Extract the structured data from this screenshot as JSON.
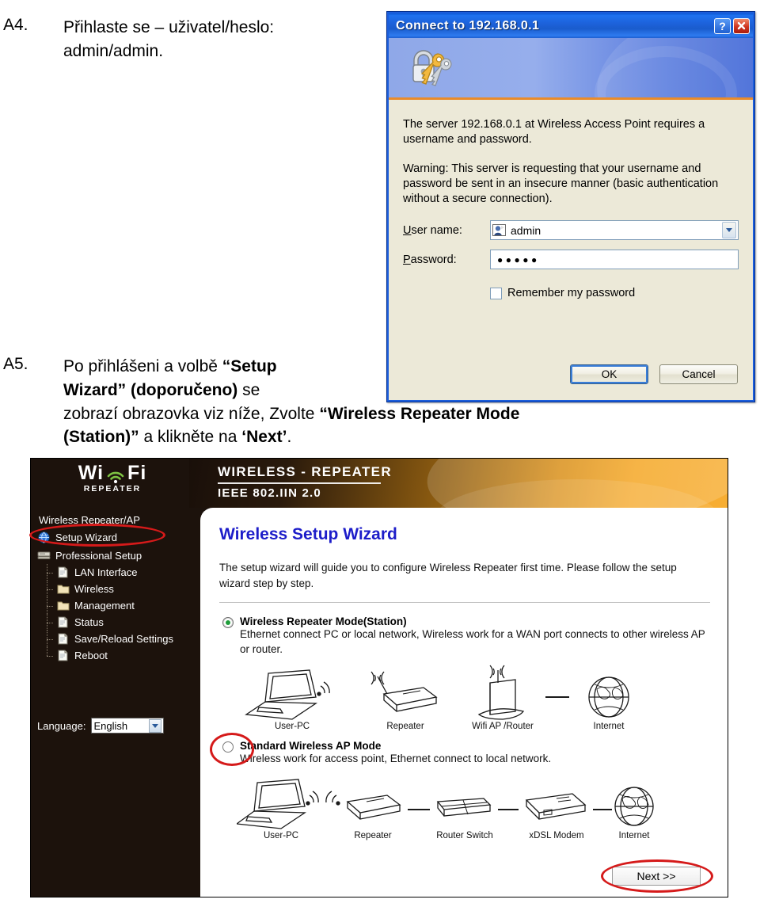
{
  "steps": [
    {
      "id": "A4",
      "label": "A4.",
      "lines": [
        "Přihlaste se – uživatel/heslo:",
        "admin/admin."
      ]
    },
    {
      "id": "A5",
      "label": "A5.",
      "line1_pre": "Po přihlášeni a volbě ",
      "line1_bold": "“Setup",
      "line2_bold": "Wizard” (doporučeno)",
      "line2_post": " se",
      "line3_pre": "zobrazí obrazovka viz níže, Zvolte ",
      "line3_bold": "“Wireless Repeater Mode",
      "line4_bold": "(Station)”",
      "line4_mid": " a klikněte na ",
      "line4_bold2": "‘Next’",
      "line4_end": "."
    }
  ],
  "auth_dialog": {
    "title": "Connect to 192.168.0.1",
    "help_button": "?",
    "close_button": "✕",
    "icon": "keys-icon",
    "message_1": "The server 192.168.0.1 at Wireless Access Point requires a username and password.",
    "message_2": "Warning: This server is requesting that your username and password be sent in an insecure manner (basic authentication without a secure connection).",
    "username_label": "User name:",
    "username_value": "admin",
    "password_label": "Password:",
    "password_value": "●●●●●",
    "remember_label": "Remember my password",
    "remember_checked": false,
    "ok_button": "OK",
    "cancel_button": "Cancel",
    "titlebar_color": "#1a5ccd",
    "body_color": "#ece9d8"
  },
  "router_ui": {
    "brand": {
      "wifi_text": "Wi Fi",
      "sub_text": "REPEATER"
    },
    "banner": {
      "title": "WIRELESS - REPEATER",
      "subtitle": "IEEE 802.IIN 2.0",
      "accent_color": "#f5a623"
    },
    "sidebar": {
      "heading": "Wireless Repeater/AP",
      "items": [
        {
          "label": "Setup Wizard",
          "icon": "globe-icon",
          "level": 0,
          "highlighted": true
        },
        {
          "label": "Professional Setup",
          "icon": "server-icon",
          "level": 0,
          "highlighted": false
        },
        {
          "label": "LAN Interface",
          "icon": "page-icon",
          "level": 1,
          "highlighted": false
        },
        {
          "label": "Wireless",
          "icon": "folder-icon",
          "level": 1,
          "highlighted": false
        },
        {
          "label": "Management",
          "icon": "folder-icon",
          "level": 1,
          "highlighted": false
        },
        {
          "label": "Status",
          "icon": "page-icon",
          "level": 1,
          "highlighted": false
        },
        {
          "label": "Save/Reload Settings",
          "icon": "page-icon",
          "level": 1,
          "highlighted": false
        },
        {
          "label": "Reboot",
          "icon": "page-icon",
          "level": 1,
          "highlighted": false
        }
      ],
      "language_label": "Language:",
      "language_value": "English"
    },
    "main": {
      "title": "Wireless Setup Wizard",
      "description": "The setup wizard will guide you to configure Wireless Repeater first time. Please follow the setup wizard step by step.",
      "modes": [
        {
          "title": "Wireless Repeater Mode(Station)",
          "description": "Ethernet connect PC or local network, Wireless work for a WAN port connects to other wireless AP or router.",
          "selected": true,
          "highlighted": false,
          "diagram_labels": [
            "User-PC",
            "Repeater",
            "Wifi AP /Router",
            "Internet"
          ]
        },
        {
          "title": "Standard Wireless AP Mode",
          "description": "Wireless work for access point, Ethernet connect to local network.",
          "selected": false,
          "highlighted": true,
          "diagram_labels": [
            "User-PC",
            "Repeater",
            "Router Switch",
            "xDSL Modem",
            "Internet"
          ]
        }
      ],
      "next_button": "Next >>",
      "highlight_color": "#d51a1a"
    }
  }
}
